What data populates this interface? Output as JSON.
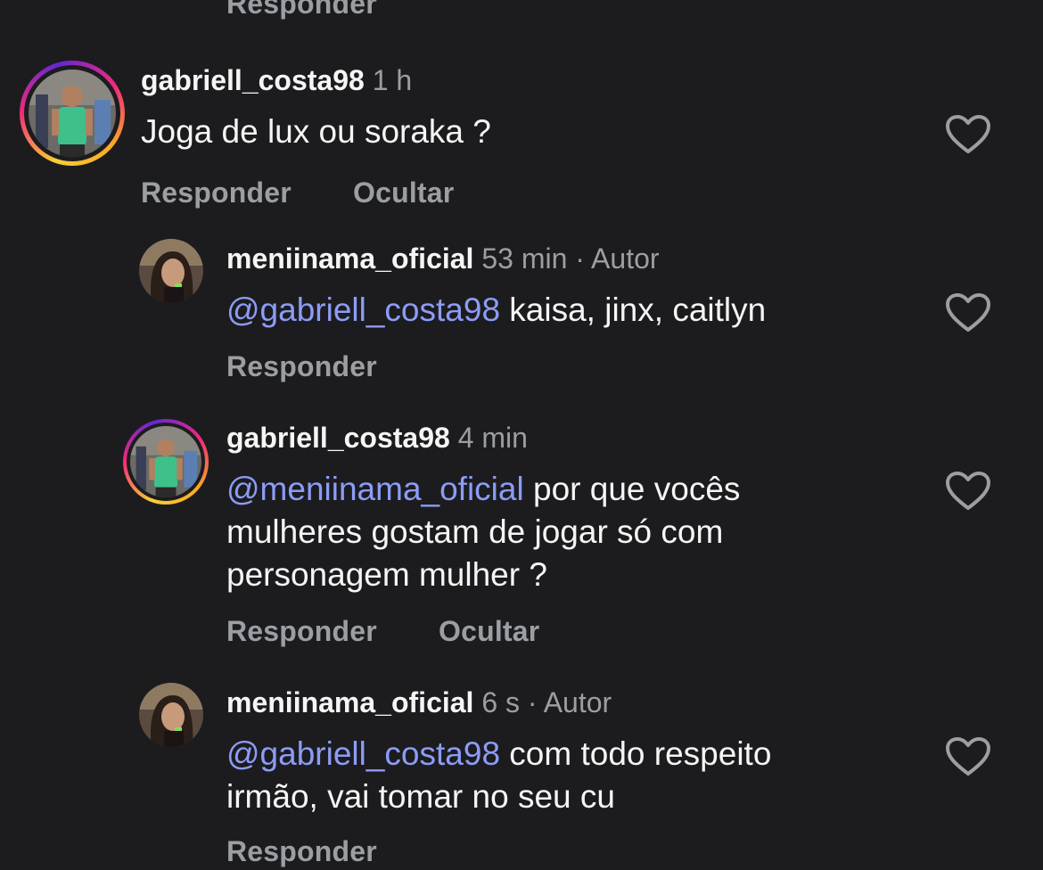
{
  "colors": {
    "background": "#1c1c1f",
    "text": "#f5f5f5",
    "secondary": "#9b9ea3",
    "mention": "#8c9cf6"
  },
  "top_action": "Responder",
  "comments": [
    {
      "username": "gabriell_costa98",
      "time": "1 h",
      "author_tag": "",
      "mention": "",
      "text": "Joga de lux ou soraka ?",
      "actions": [
        "Responder",
        "Ocultar"
      ],
      "avatar_icon": "avatar-story-ring-icon",
      "like_icon": "heart-outline-icon"
    },
    {
      "username": "meniinama_oficial",
      "time": "53 min",
      "author_tag": "· Autor",
      "mention": "@gabriell_costa98",
      "text": " kaisa, jinx, caitlyn",
      "actions": [
        "Responder"
      ],
      "avatar_icon": "avatar-icon",
      "like_icon": "heart-outline-icon"
    },
    {
      "username": "gabriell_costa98",
      "time": "4 min",
      "author_tag": "",
      "mention": "@meniinama_oficial",
      "text": " por que vocês\nmulheres gostam de jogar só com\npersonagem mulher ?",
      "actions": [
        "Responder",
        "Ocultar"
      ],
      "avatar_icon": "avatar-story-ring-icon",
      "like_icon": "heart-outline-icon"
    },
    {
      "username": "meniinama_oficial",
      "time": "6 s",
      "author_tag": "· Autor",
      "mention": "@gabriell_costa98",
      "text": " com todo respeito\nirmão, vai tomar no seu cu",
      "actions": [
        "Responder"
      ],
      "avatar_icon": "avatar-icon",
      "like_icon": "heart-outline-icon"
    }
  ]
}
